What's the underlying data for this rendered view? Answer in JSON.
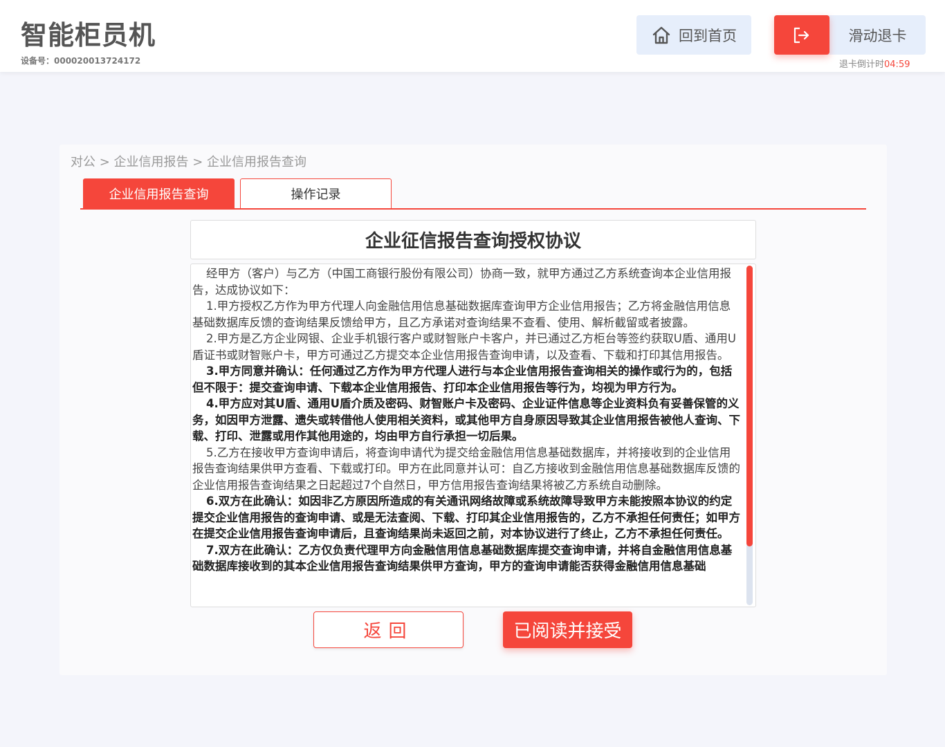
{
  "header": {
    "app_title": "智能柜员机",
    "device_id": "设备号：000020013724172",
    "home_label": "回到首页",
    "exit_card_label": "滑动退卡",
    "countdown_label": "退卡倒计时",
    "countdown_time": "04:59"
  },
  "breadcrumb": "对公 > 企业信用报告 > 企业信用报告查询",
  "tabs": [
    {
      "label": "企业信用报告查询",
      "active": true
    },
    {
      "label": "操作记录",
      "active": false
    }
  ],
  "agreement": {
    "title": "企业征信报告查询授权协议",
    "paragraphs": [
      {
        "text": "经甲方（客户）与乙方（中国工商银行股份有限公司）协商一致，就甲方通过乙方系统查询本企业信用报告，达成协议如下：",
        "bold": false
      },
      {
        "text": "1.甲方授权乙方作为甲方代理人向金融信用信息基础数据库查询甲方企业信用报告；乙方将金融信用信息基础数据库反馈的查询结果反馈给甲方，且乙方承诺对查询结果不查看、使用、解析截留或者披露。",
        "bold": false
      },
      {
        "text": "2.甲方是乙方企业网银、企业手机银行客户或财智账户卡客户，并已通过乙方柜台等签约获取U盾、通用U盾证书或财智账户卡，甲方可通过乙方提交本企业信用报告查询申请，以及查看、下载和打印其信用报告。",
        "bold": false
      },
      {
        "text": "3.甲方同意并确认：任何通过乙方作为甲方代理人进行与本企业信用报告查询相关的操作或行为的，包括但不限于：提交查询申请、下载本企业信用报告、打印本企业信用报告等行为，均视为甲方行为。",
        "bold": true
      },
      {
        "text": "4.甲方应对其U盾、通用U盾介质及密码、财智账户卡及密码、企业证件信息等企业资料负有妥善保管的义务，如因甲方泄露、遗失或转借他人使用相关资料，或其他甲方自身原因导致其企业信用报告被他人查询、下载、打印、泄露或用作其他用途的，均由甲方自行承担一切后果。",
        "bold": true
      },
      {
        "text": "5.乙方在接收甲方查询申请后，将查询申请代为提交给金融信用信息基础数据库，并将接收到的企业信用报告查询结果供甲方查看、下载或打印。甲方在此同意并认可：自乙方接收到金融信用信息基础数据库反馈的企业信用报告查询结果之日起超过7个自然日，甲方信用报告查询结果将被乙方系统自动删除。",
        "bold": false
      },
      {
        "text": "6.双方在此确认：如因非乙方原因所造成的有关通讯网络故障或系统故障导致甲方未能按照本协议的约定提交企业信用报告的查询申请、或是无法查阅、下载、打印其企业信用报告的，乙方不承担任何责任；如甲方在提交企业信用报告查询申请后，且查询结果尚未返回之前，对本协议进行了终止，乙方不承担任何责任。",
        "bold": true
      },
      {
        "text": "7.双方在此确认：乙方仅负责代理甲方向金融信用信息基础数据库提交查询申请，并将自金融信用信息基础数据库接收到的其本企业信用报告查询结果供甲方查询，甲方的查询申请能否获得金融信用信息基础",
        "bold": true
      }
    ],
    "scroll_position": 0
  },
  "buttons": {
    "back": "返回",
    "accept": "已阅读并接受"
  },
  "colors": {
    "accent": "#f5463b",
    "home_button_bg": "#e6eefb",
    "page_bg": "#f4f5fb"
  }
}
